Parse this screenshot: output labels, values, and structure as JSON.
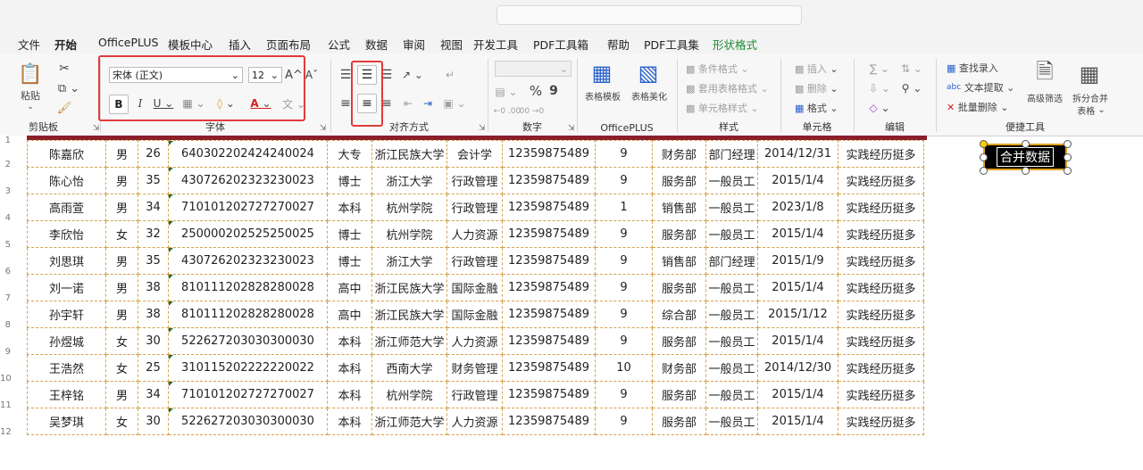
{
  "menu": [
    "文件",
    "开始",
    "OfficePLUS",
    "模板中心",
    "插入",
    "页面布局",
    "公式",
    "数据",
    "审阅",
    "视图",
    "开发工具",
    "PDF工具箱",
    "帮助",
    "PDF工具集",
    "形状格式"
  ],
  "ribbon": {
    "clipboard": {
      "paste": "粘贴",
      "label": "剪贴板"
    },
    "font": {
      "name": "宋体 (正文)",
      "size": "12",
      "bold": "B",
      "italic": "I",
      "underline": "U",
      "grow": "A^",
      "shrink": "Aˇ",
      "label": "字体"
    },
    "align": {
      "label": "对齐方式"
    },
    "number": {
      "percent": "%",
      "comma": "9",
      "inc": "←0 .00",
      "dec": ".00 →0",
      "label": "数字"
    },
    "officeplus": {
      "table_template": "表格模板",
      "table_beautify": "表格美化",
      "label": "OfficePLUS"
    },
    "styles": {
      "cond": "条件格式",
      "table": "套用表格格式",
      "cell": "单元格样式",
      "label": "样式"
    },
    "cells": {
      "insert": "插入",
      "delete": "删除",
      "format": "格式",
      "label": "单元格"
    },
    "edit": {
      "label": "编辑"
    },
    "tools": {
      "find": "查找录入",
      "extract": "文本提取",
      "batch_delete": "批量删除",
      "adv_filter": "高级筛选",
      "split_merge": "拆分合并",
      "table": "表格",
      "label": "便捷工具"
    }
  },
  "row_numbers": [
    "1",
    "2",
    "3",
    "4",
    "5",
    "6",
    "7",
    "8",
    "9",
    "10",
    "11",
    "12"
  ],
  "rows": [
    [
      "陈嘉欣",
      "男",
      "26",
      "640302202424240024",
      "大专",
      "浙江民族大学",
      "会计学",
      "12359875489",
      "9",
      "财务部",
      "部门经理",
      "2014/12/31",
      "实践经历挺多"
    ],
    [
      "陈心怡",
      "男",
      "35",
      "430726202323230023",
      "博士",
      "浙江大学",
      "行政管理",
      "12359875489",
      "9",
      "服务部",
      "一般员工",
      "2015/1/4",
      "实践经历挺多"
    ],
    [
      "高雨萱",
      "男",
      "34",
      "710101202727270027",
      "本科",
      "杭州学院",
      "行政管理",
      "12359875489",
      "1",
      "销售部",
      "一般员工",
      "2023/1/8",
      "实践经历挺多"
    ],
    [
      "李欣怡",
      "女",
      "32",
      "250000202525250025",
      "博士",
      "杭州学院",
      "人力资源",
      "12359875489",
      "9",
      "服务部",
      "一般员工",
      "2015/1/4",
      "实践经历挺多"
    ],
    [
      "刘思琪",
      "男",
      "35",
      "430726202323230023",
      "博士",
      "浙江大学",
      "行政管理",
      "12359875489",
      "9",
      "销售部",
      "部门经理",
      "2015/1/9",
      "实践经历挺多"
    ],
    [
      "刘一诺",
      "男",
      "38",
      "810111202828280028",
      "高中",
      "浙江民族大学",
      "国际金融",
      "12359875489",
      "9",
      "服务部",
      "一般员工",
      "2015/1/4",
      "实践经历挺多"
    ],
    [
      "孙宇轩",
      "男",
      "38",
      "810111202828280028",
      "高中",
      "浙江民族大学",
      "国际金融",
      "12359875489",
      "9",
      "综合部",
      "一般员工",
      "2015/1/12",
      "实践经历挺多"
    ],
    [
      "孙煜城",
      "女",
      "30",
      "522627203030300030",
      "本科",
      "浙江师范大学",
      "人力资源",
      "12359875489",
      "9",
      "服务部",
      "一般员工",
      "2015/1/4",
      "实践经历挺多"
    ],
    [
      "王浩然",
      "女",
      "25",
      "310115202222220022",
      "本科",
      "西南大学",
      "财务管理",
      "12359875489",
      "10",
      "财务部",
      "一般员工",
      "2014/12/30",
      "实践经历挺多"
    ],
    [
      "王梓铭",
      "男",
      "34",
      "710101202727270027",
      "本科",
      "杭州学院",
      "行政管理",
      "12359875489",
      "9",
      "服务部",
      "一般员工",
      "2015/1/4",
      "实践经历挺多"
    ],
    [
      "吴梦琪",
      "女",
      "30",
      "522627203030300030",
      "本科",
      "浙江师范大学",
      "人力资源",
      "12359875489",
      "9",
      "服务部",
      "一般员工",
      "2015/1/4",
      "实践经历挺多"
    ]
  ],
  "shape_button": "合并数据",
  "colors": {
    "accent": "#1e7145",
    "highlight": "#e23b3b",
    "header_line": "#8b1e2b",
    "cell_border": "#d4a24c"
  }
}
